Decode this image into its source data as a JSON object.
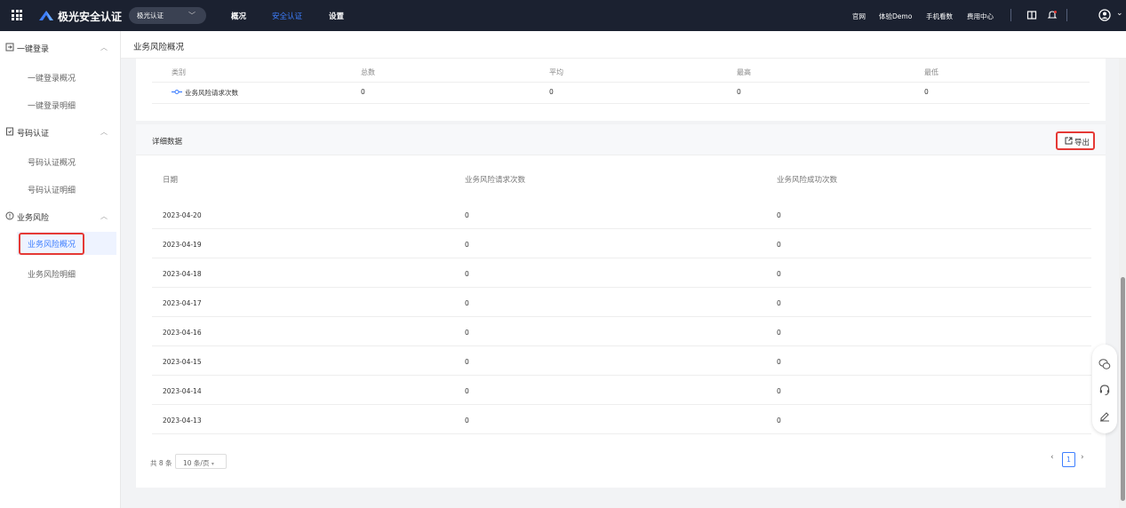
{
  "topbar": {
    "brand": "极光安全认证",
    "app_select": "极光认证",
    "nav": [
      "概况",
      "安全认证",
      "设置"
    ],
    "links": [
      "官网",
      "体验Demo",
      "手机看数",
      "费用中心"
    ]
  },
  "sidebar": {
    "groups": [
      {
        "label": "一键登录",
        "items": [
          "一键登录概况",
          "一键登录明细"
        ]
      },
      {
        "label": "号码认证",
        "items": [
          "号码认证概况",
          "号码认证明细"
        ]
      },
      {
        "label": "业务风险",
        "items": [
          "业务风险概况",
          "业务风险明细"
        ]
      }
    ]
  },
  "page": {
    "title": "业务风险概况"
  },
  "summary": {
    "headers": [
      "类别",
      "总数",
      "平均",
      "最高",
      "最低"
    ],
    "row": {
      "category": "业务风险请求次数",
      "total": "0",
      "avg": "0",
      "max": "0",
      "min": "0"
    }
  },
  "detail": {
    "title": "详细数据",
    "export_label": "导出",
    "headers": [
      "日期",
      "业务风险请求次数",
      "业务风险成功次数"
    ],
    "rows": [
      {
        "date": "2023-04-20",
        "req": "0",
        "ok": "0"
      },
      {
        "date": "2023-04-19",
        "req": "0",
        "ok": "0"
      },
      {
        "date": "2023-04-18",
        "req": "0",
        "ok": "0"
      },
      {
        "date": "2023-04-17",
        "req": "0",
        "ok": "0"
      },
      {
        "date": "2023-04-16",
        "req": "0",
        "ok": "0"
      },
      {
        "date": "2023-04-15",
        "req": "0",
        "ok": "0"
      },
      {
        "date": "2023-04-14",
        "req": "0",
        "ok": "0"
      },
      {
        "date": "2023-04-13",
        "req": "0",
        "ok": "0"
      }
    ]
  },
  "pager": {
    "total": "共 8 条",
    "page_size": "10 条/页",
    "current": "1"
  },
  "colors": {
    "accent": "#3d7eff",
    "topbar_bg": "#1b2130",
    "highlight_red": "#e53935"
  }
}
